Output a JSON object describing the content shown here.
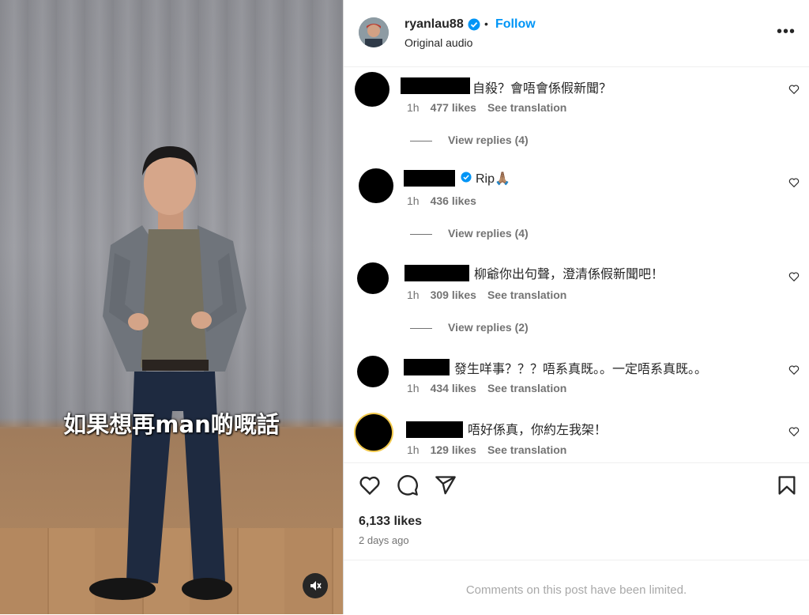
{
  "video": {
    "subtitle": "如果想再man啲嘅話",
    "mute_icon": "speaker-muted-icon"
  },
  "header": {
    "username": "ryanlau88",
    "separator": "•",
    "follow_label": "Follow",
    "audio_label": "Original audio",
    "more_label": "•••",
    "verified_color": "#0095f6"
  },
  "comments": [
    {
      "text": "自殺？會唔會係假新聞？",
      "time": "1h",
      "likes": "477 likes",
      "translate": "See translation",
      "replies": "View replies (4)"
    },
    {
      "text": "Rip🙏🏽",
      "time": "1h",
      "likes": "436 likes",
      "translate": "",
      "replies": "View replies (4)"
    },
    {
      "text": "柳爺你出句聲，澄清係假新聞吧！",
      "time": "1h",
      "likes": "309 likes",
      "translate": "See translation",
      "replies": "View replies (2)"
    },
    {
      "text": "發生咩事？？？唔系真既。。一定唔系真既。。",
      "time": "1h",
      "likes": "434 likes",
      "translate": "See translation",
      "replies": ""
    },
    {
      "text": "唔好係真，你約左我架！",
      "time": "1h",
      "likes": "129 likes",
      "translate": "See translation",
      "replies": ""
    }
  ],
  "post": {
    "likes": "6,133 likes",
    "posted": "2 days ago",
    "limited_notice": "Comments on this post have been limited."
  },
  "icons": {
    "like": "heart-icon",
    "comment": "comment-icon",
    "share": "share-icon",
    "save": "bookmark-icon"
  }
}
